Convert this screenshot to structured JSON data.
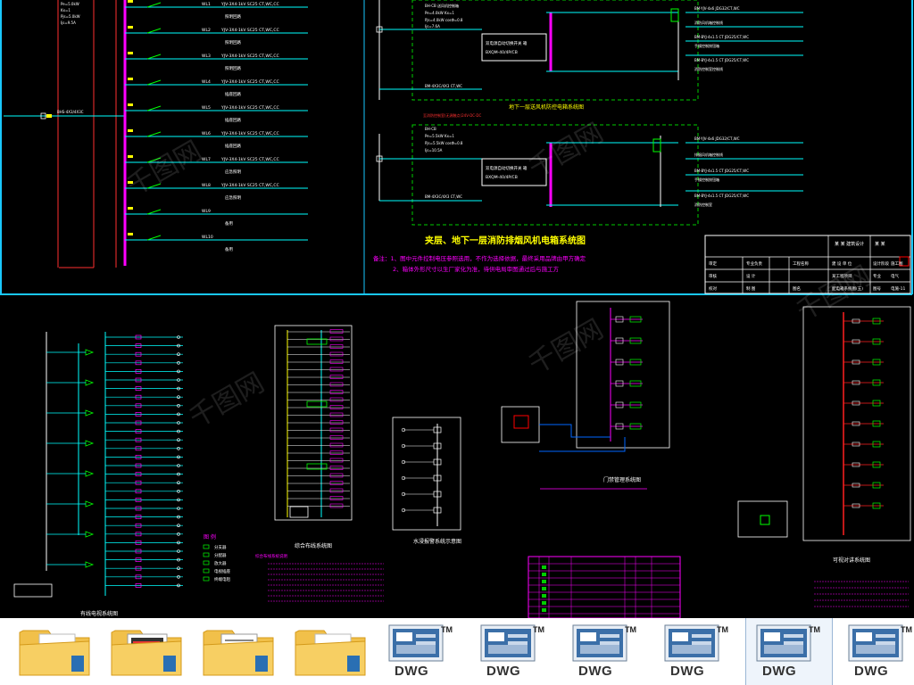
{
  "drawing": {
    "main_title": "夹层、地下一层消防排烟风机电箱系统图",
    "sub_title_top": "地下一层送风机防控电箱系统图",
    "notes": [
      "备注：1、图中元件控制电压参照选用，不作为选择依据，最终采用品牌由甲方确定",
      "2、箱体外形尺寸以生厂家化为准，待供电局审图通过后与施工方"
    ],
    "left_feed_label": "BHS-4X3/4X3C",
    "left_meta": [
      "Pe=5.0kW",
      "Kx=1",
      "Pjs=5.0kW",
      "Ijs=9.5A",
      "cosΦ=0.8"
    ],
    "branch_labels": [
      {
        "code": "WL1",
        "cable": "YJV-3X4-1kV  SC25 CT,WC,CC",
        "desc": "照明回路"
      },
      {
        "code": "WL2",
        "cable": "YJV-3X4-1kV  SC25 CT,WC,CC",
        "desc": "照明回路"
      },
      {
        "code": "WL3",
        "cable": "YJV-3X4-1kV  SC25 CT,WC,CC",
        "desc": "照明回路"
      },
      {
        "code": "WL4",
        "cable": "YJV-3X4-1kV  SC25 CT,WC,CC",
        "desc": "插座回路"
      },
      {
        "code": "WL5",
        "cable": "YJV-3X4-1kV  SC25 CT,WC,CC",
        "desc": "插座回路"
      },
      {
        "code": "WL6",
        "cable": "YJV-3X4-1kV  SC25 CT,WC,CC",
        "desc": "插座回路"
      },
      {
        "code": "WL7",
        "cable": "YJV-3X4-1kV  SC25 CT,WC,CC",
        "desc": "应急照明"
      },
      {
        "code": "WL8",
        "cable": "YJV-3X4-1kV  SC25 CT,WC,CC",
        "desc": "应急照明"
      },
      {
        "code": "WL9",
        "cable": "",
        "desc": "备用"
      },
      {
        "code": "WL10",
        "cable": "",
        "desc": "备用"
      }
    ],
    "box_label_1": "双电源自动切换开关 箱",
    "box_label_2": "双电源自动切换开关 箱",
    "box_model": "BXQM-40/4P/CB",
    "upper_circuit_lines": [
      "BH-CB 送风机控制箱",
      "Pe=4.0kW  Kx=1",
      "Pjs=4.0kW  cosΦ=0.8",
      "Ijs=7.6A",
      "BM-4X3C/4X3 CT,WC"
    ],
    "upper_out_lines": [
      "BM-YJV-4x6 JDG32/CT,WC",
      "消防风机箱控制线",
      "BM-BYJ-4x1.5 CT JDG25/CT,WC",
      "手操控制按钮箱",
      "BM-BYJ-4x1.5 CT JDG25/CT,WC",
      "消防控制室控制线"
    ],
    "lower_header": "至消防控制室(无源触点)24V·DC·DC",
    "lower_circuit_lines": [
      "BH-CB",
      "Pe=5.5kW  Kx=1",
      "Pjs=5.5kW  cosΦ=0.8",
      "Ijs=10.5A",
      "BM-4X3C/4X3 CT,WC"
    ],
    "lower_out_lines": [
      "BM-YJV-4x6 JDG32/CT,WC",
      "排烟风机箱控制线",
      "BM-BYJ-4x1.5 CT JDG25/CT,WC",
      "手操控制按钮箱",
      "BM-BYJ-4x1.5 CT JDG25/CT,WC",
      "消防控制室"
    ],
    "title_block": {
      "rows": [
        [
          "审定",
          "专业负责",
          "工程名称",
          "建 设 单 位",
          "设计阶段",
          "施工图"
        ],
        [
          "审核",
          "设 计",
          "",
          "",
          "专业",
          "电气"
        ],
        [
          "校对",
          "制 图",
          "图名",
          "配电箱系统图(五)",
          "图号",
          "电施-11"
        ]
      ],
      "company": "某 某 建筑设计",
      "project": "某工程项目",
      "date": "日期",
      "sheet": "某 某"
    },
    "sub_diagrams": [
      {
        "title": "有线电视系统图"
      },
      {
        "title": "综合布线系统图"
      },
      {
        "title": "水浸报警系统示意图"
      },
      {
        "title": "门禁管理系统图"
      },
      {
        "title": "可视对讲系统图"
      }
    ],
    "legend_title": "图 例",
    "legend_items": [
      "分支器",
      "分配器",
      "放大器",
      "电视插座",
      "终端电阻"
    ],
    "notes_block_title": "综合布线系统说明",
    "watermark": "千图网"
  },
  "thumbnails": [
    {
      "type": "folder",
      "label": ""
    },
    {
      "type": "folder-doc",
      "label": ""
    },
    {
      "type": "folder-doc2",
      "label": ""
    },
    {
      "type": "folder",
      "label": ""
    },
    {
      "type": "dwg",
      "label": "DWG",
      "tm": "TM"
    },
    {
      "type": "dwg",
      "label": "DWG",
      "tm": "TM"
    },
    {
      "type": "dwg",
      "label": "DWG",
      "tm": "TM"
    },
    {
      "type": "dwg",
      "label": "DWG",
      "tm": "TM"
    },
    {
      "type": "dwg",
      "label": "DWG",
      "tm": "TM",
      "selected": true
    },
    {
      "type": "dwg",
      "label": "DWG",
      "tm": "TM"
    }
  ]
}
